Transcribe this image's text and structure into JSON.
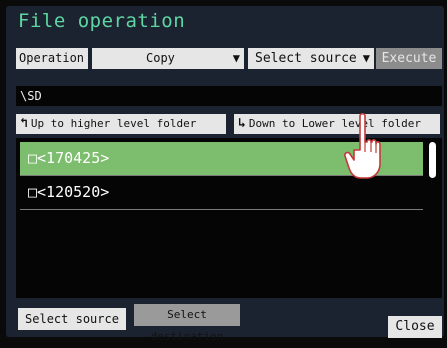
{
  "window": {
    "title": "File operation"
  },
  "operation": {
    "label": "Operation",
    "selected": "Copy",
    "source_select": "Select source",
    "execute": "Execute"
  },
  "path": "\\SD",
  "nav": {
    "up": "Up to higher level folder",
    "down": "Down to Lower level folder"
  },
  "folders": [
    {
      "checkbox": "□",
      "name": "<170425>",
      "selected": true
    },
    {
      "checkbox": "□",
      "name": "<120520>",
      "selected": false
    }
  ],
  "footer": {
    "select_source": "Select source",
    "select_destination": "Select destination",
    "close": "Close"
  },
  "colors": {
    "title": "#5ed6a2",
    "selected_row": "#7dbe6e",
    "panel": "#1c2330"
  }
}
